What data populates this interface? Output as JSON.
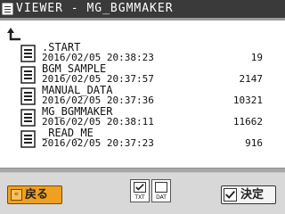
{
  "titlebar": {
    "title": "VIEWER - MG_BGMMAKER",
    "icon": "folder-icon"
  },
  "navigation": {
    "up_icon": "up-arrow-icon"
  },
  "files": [
    {
      "name": ".START",
      "date": "2016/02/05 20:38:23",
      "size": "19"
    },
    {
      "name": "BGM_SAMPLE",
      "date": "2016/02/05 20:37:57",
      "size": "2147"
    },
    {
      "name": "MANUAL_DATA",
      "date": "2016/02/05 20:37:36",
      "size": "10321"
    },
    {
      "name": "MG_BGMMAKER",
      "date": "2016/02/05 20:38:11",
      "size": "11662"
    },
    {
      "name": "_READ_ME",
      "date": "2016/02/05 20:37:23",
      "size": "916"
    }
  ],
  "bottombar": {
    "back_label": "戻る",
    "txt_label": "TXT",
    "dat_label": "DAT",
    "txt_checked": true,
    "dat_checked": false,
    "confirm_label": "決定"
  },
  "colors": {
    "titlebar_bg": "#3a3a3a",
    "back_button": "#f0a020",
    "bottombar_bg": "#d8d8d8"
  }
}
